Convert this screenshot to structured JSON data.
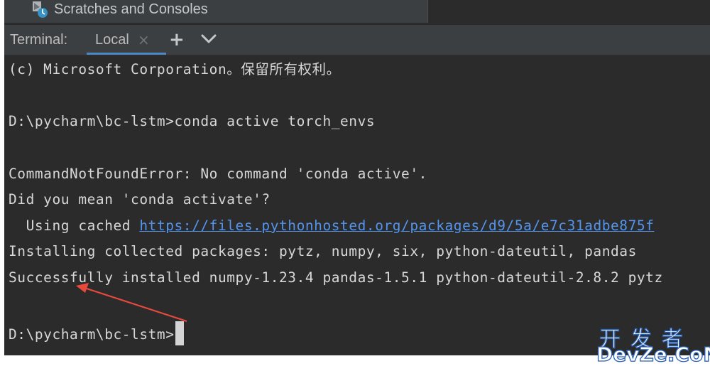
{
  "panel": {
    "scratches_label": "Scratches and Consoles"
  },
  "toolbar": {
    "title": "Terminal:",
    "tab_label": "Local",
    "tab_close": "×",
    "add": "+"
  },
  "terminal": {
    "lines": [
      "(c) Microsoft Corporation。保留所有权利。",
      "D:\\pycharm\\bc-lstm>conda active torch_envs",
      "CommandNotFoundError: No command 'conda active'.",
      "Did you mean 'conda activate'?",
      "  Using cached ",
      "Installing collected packages: pytz, numpy, six, python-dateutil, pandas",
      "Successfully installed numpy-1.23.4 pandas-1.5.1 python-dateutil-2.8.2 pytz",
      "D:\\pycharm\\bc-lstm>"
    ],
    "link_url": "https://files.pythonhosted.org/packages/d9/5a/e7c31adbe875f"
  },
  "watermark": {
    "chinese": "开发者",
    "latin": "DevZe.CoM"
  },
  "colors": {
    "background": "#2b2b2b",
    "link": "#5394ec",
    "tab_underline": "#4a88c7",
    "annotation_arrow": "#e8493c"
  }
}
